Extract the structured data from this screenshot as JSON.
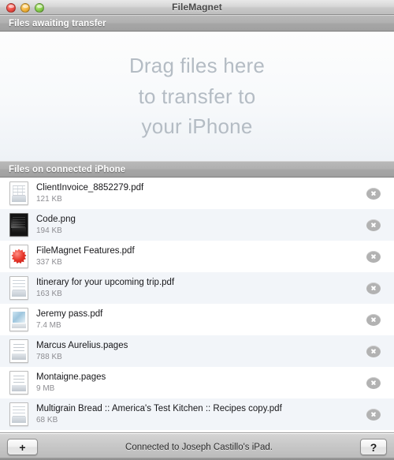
{
  "window": {
    "title": "FileMagnet",
    "controls": [
      {
        "name": "close-button",
        "color": "#f05249"
      },
      {
        "name": "minimize-button",
        "color": "#f5b844"
      },
      {
        "name": "zoom-button",
        "color": "#8ed252"
      }
    ]
  },
  "awaiting_section": {
    "header": "Files awaiting transfer",
    "dropzone_lines": [
      "Drag files here",
      "to transfer to",
      "your iPhone"
    ]
  },
  "device_section": {
    "header": "Files on connected iPhone",
    "files": [
      {
        "name": "ClientInvoice_8852279.pdf",
        "size": "121 KB",
        "icon": "pdf-invoice-icon",
        "icon_variant": "invoice"
      },
      {
        "name": "Code.png",
        "size": "194 KB",
        "icon": "png-screenshot-icon",
        "icon_variant": "dark"
      },
      {
        "name": "FileMagnet Features.pdf",
        "size": "337 KB",
        "icon": "pdf-starburst-icon",
        "icon_variant": "burst"
      },
      {
        "name": "Itinerary for your upcoming trip.pdf",
        "size": "163 KB",
        "icon": "pdf-document-icon",
        "icon_variant": "doc"
      },
      {
        "name": "Jeremy pass.pdf",
        "size": "7.4 MB",
        "icon": "pdf-photo-icon",
        "icon_variant": "photo"
      },
      {
        "name": "Marcus Aurelius.pages",
        "size": "788 KB",
        "icon": "pages-document-icon",
        "icon_variant": "pages"
      },
      {
        "name": "Montaigne.pages",
        "size": "9 MB",
        "icon": "pages-document-icon",
        "icon_variant": "pages"
      },
      {
        "name": "Multigrain Bread :: America's Test Kitchen :: Recipes copy.pdf",
        "size": "68 KB",
        "icon": "pdf-document-icon",
        "icon_variant": "doc"
      }
    ],
    "delete_icon": "remove-circle-icon"
  },
  "toolbar": {
    "add_label": "+",
    "add_icon": "plus-icon",
    "help_label": "?",
    "help_icon": "question-mark-icon",
    "status": "Connected to Joseph Castillo's iPad."
  },
  "colors": {
    "accent_header_bar": "#a9a9a9",
    "dropzone_text": "#b4bcc4",
    "row_alt": "#f2f5f9",
    "delete_button": "#b2b2b2",
    "starburst_red": "#e8372b"
  }
}
